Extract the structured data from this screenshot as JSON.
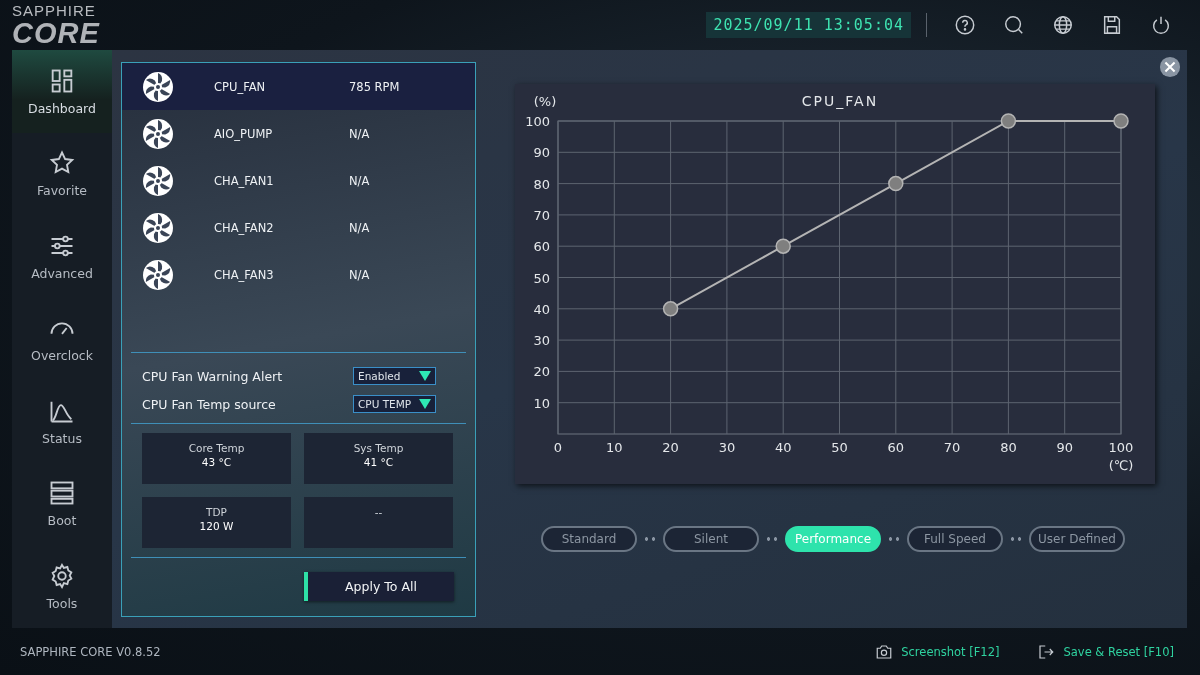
{
  "header": {
    "logo_top": "SAPPHIRE",
    "logo_main": "CORE",
    "datetime": "2025/09/11 13:05:04"
  },
  "sidebar": {
    "items": [
      {
        "label": "Dashboard",
        "selected": true
      },
      {
        "label": "Favorite",
        "selected": false
      },
      {
        "label": "Advanced",
        "selected": false
      },
      {
        "label": "Overclock",
        "selected": false
      },
      {
        "label": "Status",
        "selected": false
      },
      {
        "label": "Boot",
        "selected": false
      },
      {
        "label": "Tools",
        "selected": false
      }
    ]
  },
  "fans": [
    {
      "name": "CPU_FAN",
      "reading": "785 RPM",
      "selected": true
    },
    {
      "name": "AIO_PUMP",
      "reading": "N/A",
      "selected": false
    },
    {
      "name": "CHA_FAN1",
      "reading": "N/A",
      "selected": false
    },
    {
      "name": "CHA_FAN2",
      "reading": "N/A",
      "selected": false
    },
    {
      "name": "CHA_FAN3",
      "reading": "N/A",
      "selected": false
    }
  ],
  "settings": [
    {
      "label": "CPU Fan Warning Alert",
      "value": "Enabled"
    },
    {
      "label": "CPU Fan Temp source",
      "value": "CPU TEMP"
    }
  ],
  "stats": [
    {
      "label": "Core Temp",
      "value": "43 °C"
    },
    {
      "label": "Sys Temp",
      "value": "41 °C"
    },
    {
      "label": "TDP",
      "value": "120 W"
    },
    {
      "label": "--"
    }
  ],
  "apply_button": "Apply To All",
  "curve": {
    "chart_data": {
      "type": "line",
      "title": "CPU_FAN",
      "xlabel": "(℃)",
      "ylabel": "(%)",
      "x": [
        20,
        40,
        60,
        80,
        100
      ],
      "grid": true,
      "series": [
        {
          "color": "#b4b4b4",
          "marker": "circle",
          "values": [
            40,
            60,
            80,
            100,
            100
          ]
        }
      ],
      "xlim": [
        0,
        100
      ],
      "ylim": [
        0,
        100
      ],
      "xticks": [
        0,
        10,
        20,
        30,
        40,
        50,
        60,
        70,
        80,
        90,
        100
      ],
      "yticks": [
        10,
        20,
        30,
        40,
        50,
        60,
        70,
        80,
        90,
        100
      ]
    }
  },
  "modes": [
    {
      "label": "Standard",
      "selected": false
    },
    {
      "label": "Silent",
      "selected": false
    },
    {
      "label": "Performance",
      "selected": true
    },
    {
      "label": "Full Speed",
      "selected": false
    },
    {
      "label": "User Defined",
      "selected": false
    }
  ],
  "footer": {
    "version": "SAPPHIRE CORE V0.8.52",
    "actions": [
      "Screenshot [F12]",
      "Save & Reset [F10]"
    ]
  }
}
